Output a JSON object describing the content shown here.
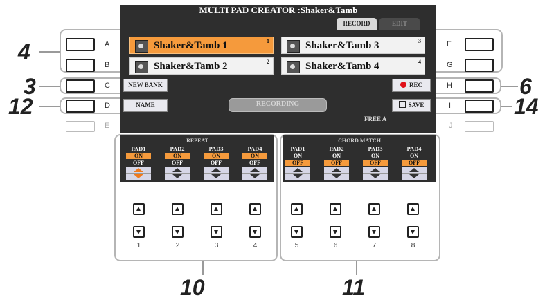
{
  "screen": {
    "title": "MULTI PAD CREATOR :Shaker&Tamb",
    "tabs": [
      {
        "label": "RECORD",
        "active": true
      },
      {
        "label": "EDIT",
        "active": false
      }
    ]
  },
  "pads": [
    {
      "name": "Shaker&Tamb 1",
      "num": "1",
      "selected": true
    },
    {
      "name": "Shaker&Tamb 2",
      "num": "2",
      "selected": false
    },
    {
      "name": "Shaker&Tamb 3",
      "num": "3",
      "selected": false
    },
    {
      "name": "Shaker&Tamb 4",
      "num": "4",
      "selected": false
    }
  ],
  "lcd_buttons": {
    "new_bank": "NEW BANK",
    "name": "NAME",
    "rec": "REC",
    "save": "SAVE",
    "recording": "RECORDING",
    "free_area": "FREE A"
  },
  "panel_labels": [
    "A",
    "B",
    "C",
    "D",
    "E",
    "F",
    "G",
    "H",
    "I",
    "J"
  ],
  "callouts": [
    "4",
    "3",
    "12",
    "6",
    "14",
    "10",
    "11"
  ],
  "repeat": {
    "heading": "REPEAT",
    "pads": [
      {
        "label": "PAD1",
        "on": "ON",
        "off": "OFF"
      },
      {
        "label": "PAD2",
        "on": "ON",
        "off": "OFF"
      },
      {
        "label": "PAD3",
        "on": "ON",
        "off": "OFF"
      },
      {
        "label": "PAD4",
        "on": "ON",
        "off": "OFF"
      }
    ]
  },
  "chord_match": {
    "heading": "CHORD MATCH",
    "pads": [
      {
        "label": "PAD1",
        "on": "ON",
        "off": "OFF"
      },
      {
        "label": "PAD2",
        "on": "ON",
        "off": "OFF"
      },
      {
        "label": "PAD3",
        "on": "ON",
        "off": "OFF"
      },
      {
        "label": "PAD4",
        "on": "ON",
        "off": "OFF"
      }
    ]
  },
  "column_numbers": [
    "1",
    "2",
    "3",
    "4",
    "5",
    "6",
    "7",
    "8"
  ],
  "colors": {
    "accent": "#f59a3c",
    "lcd": "#2e2e2e"
  }
}
